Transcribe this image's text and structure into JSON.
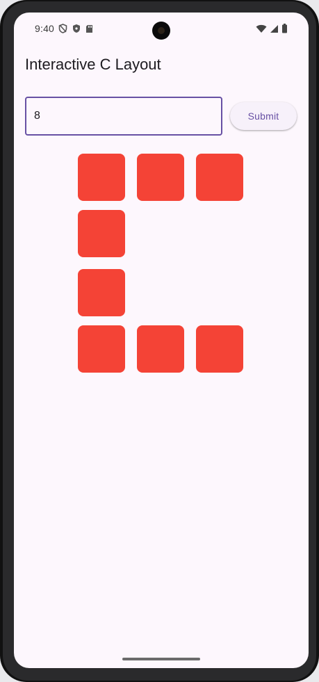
{
  "status_bar": {
    "time": "9:40",
    "left_icons": [
      "shield-off-icon",
      "shield-check-icon",
      "sd-card-icon"
    ],
    "right_icons": [
      "wifi-icon",
      "cellular-signal-icon",
      "battery-icon"
    ]
  },
  "app": {
    "title": "Interactive C Layout"
  },
  "input": {
    "value": "8",
    "placeholder": ""
  },
  "submit": {
    "label": "Submit"
  },
  "grid": {
    "tile_color": "#f44336",
    "tile_count": 8,
    "pattern": [
      "XXX",
      "X..",
      "X..",
      "XXX"
    ]
  },
  "colors": {
    "accent": "#6750a4",
    "background": "#fdf7fd",
    "tile": "#f44336"
  }
}
